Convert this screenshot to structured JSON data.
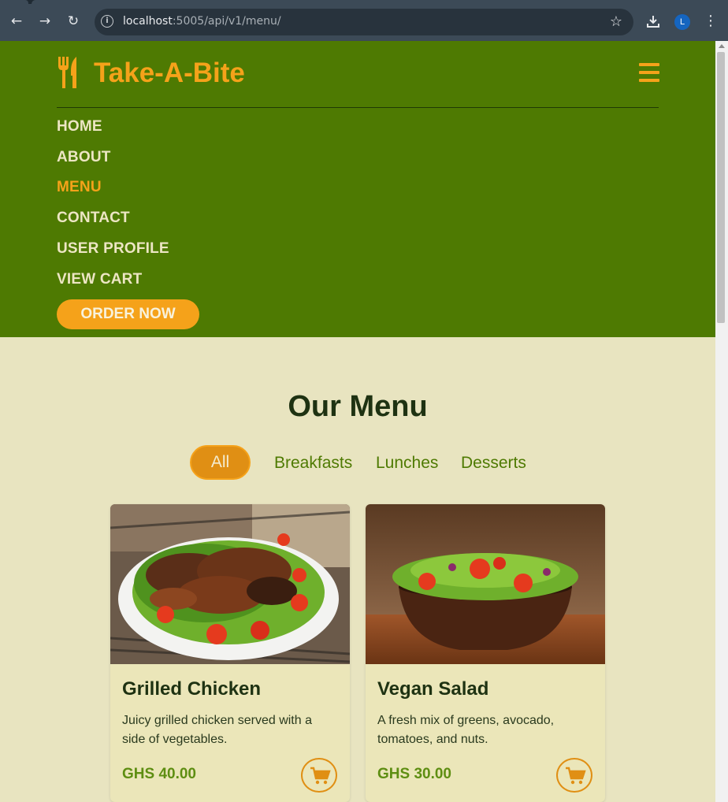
{
  "browser": {
    "url_host": "localhost",
    "url_rest": ":5005/api/v1/menu/",
    "profile_initial": "L"
  },
  "header": {
    "brand": "Take-A-Bite",
    "nav": [
      "HOME",
      "ABOUT",
      "MENU",
      "CONTACT",
      "USER PROFILE",
      "VIEW CART"
    ],
    "active_nav": "MENU",
    "order_button": "ORDER NOW"
  },
  "menu": {
    "title": "Our Menu",
    "filters": [
      "All",
      "Breakfasts",
      "Lunches",
      "Desserts"
    ],
    "active_filter": "All",
    "items": [
      {
        "name": "Grilled Chicken",
        "description": "Juicy grilled chicken served with a side of vegetables.",
        "price": "GHS 40.00"
      },
      {
        "name": "Vegan Salad",
        "description": "A fresh mix of greens, avocado, tomatoes, and nuts.",
        "price": "GHS 30.00"
      }
    ]
  },
  "colors": {
    "header_green": "#4e7a02",
    "accent_orange": "#f5a21a",
    "page_bg": "#e8e4c0"
  }
}
